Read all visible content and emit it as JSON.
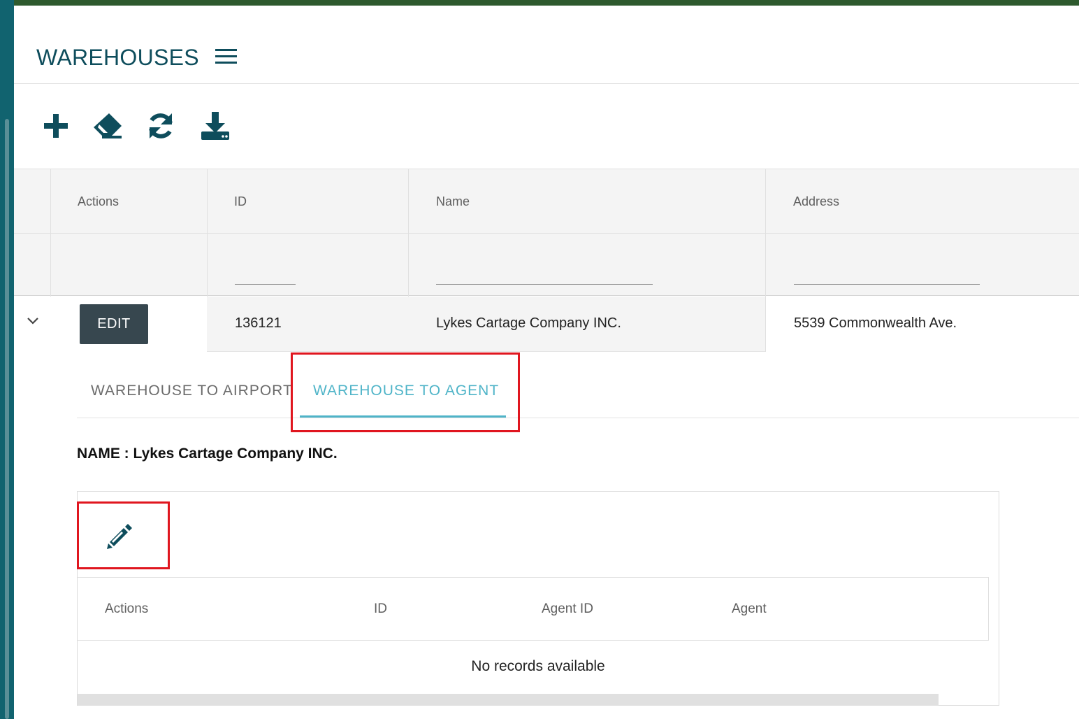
{
  "page": {
    "title": "WAREHOUSES",
    "menu_icon": "hamburger-menu-icon"
  },
  "toolbar": {
    "add_icon": "plus-icon",
    "clear_icon": "eraser-icon",
    "refresh_icon": "refresh-icon",
    "export_icon": "download-icon"
  },
  "grid": {
    "columns": [
      "Actions",
      "ID",
      "Name",
      "Address"
    ],
    "rows": [
      {
        "expand_icon": "chevron-down-icon",
        "edit_label": "EDIT",
        "id": "136121",
        "name": "Lykes Cartage Company INC.",
        "address": "5539 Commonwealth Ave."
      }
    ]
  },
  "detail": {
    "tabs": [
      "WAREHOUSE TO AIRPORT",
      "WAREHOUSE TO AGENT"
    ],
    "active_tab": "WAREHOUSE TO AGENT",
    "name_label": "NAME :",
    "name_value": "Lykes Cartage Company INC.",
    "edit_icon": "pencil-icon",
    "columns": [
      "Actions",
      "ID",
      "Agent ID",
      "Agent"
    ],
    "empty_message": "No records available"
  },
  "colors": {
    "brand": "#0e4d5c",
    "accent": "#4fb4c8",
    "highlight": "#e0161f",
    "edit_button": "#37474f"
  }
}
